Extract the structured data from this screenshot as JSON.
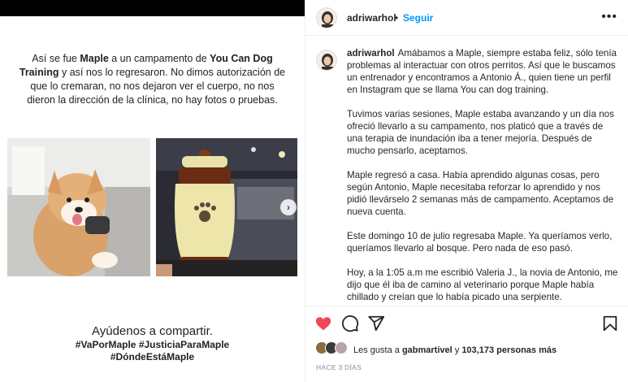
{
  "post_image": {
    "intro": {
      "t1": "Así se fue ",
      "name": "Maple",
      "t2": " a un campamento de ",
      "brand": "You Can Dog Training",
      "t3": " y así nos lo regresaron. No dimos autorización de que lo cremaran, no nos dejaron ver el cuerpo, no nos dieron la dirección de la clínica, no hay fotos o pruebas."
    },
    "cta": "Ayúdenos a compartir.",
    "hashtags_1": "#VaPorMaple #JusticiaParaMaple",
    "hashtags_2": "#DóndeEstáMaple",
    "next_icon": "chevron-right-icon"
  },
  "header": {
    "username": "adriwarhol",
    "separator": "•",
    "follow_label": "Seguir",
    "more_icon": "more-horizontal-icon"
  },
  "caption": {
    "username": "adriwarhol",
    "p1": "Amábamos a Maple, siempre estaba feliz, sólo tenía problemas al interactuar con otros perritos. Así que le buscamos un entrenador y encontramos a Antonio Á., quien tiene un perfil en Instagram que se llama You can dog training.",
    "p2": "Tuvimos varias sesiones, Maple estaba avanzando y un día nos ofreció llevarlo a su campamento, nos platicó que a través de una terapia de inundación iba a tener mejoría. Después de mucho pensarlo, aceptamos.",
    "p3": "Maple regresó a casa. Había aprendido algunas cosas, pero según Antonio, Maple necesitaba reforzar lo aprendido y nos pidió llevárselo 2 semanas más de campamento. Aceptamos de nueva cuenta.",
    "p4": "Este domingo 10 de julio regresaba Maple. Ya queríamos verlo, queríamos llevarlo al bosque. Pero nada de eso pasó.",
    "p5": "Hoy, a la 1:05 a.m me escribió Valeria J., la novia de Antonio, me dijo que él iba de camino al veterinario porque Maple había chillado y creían que lo había picado una serpiente."
  },
  "actions": {
    "like_icon": "heart-filled-icon",
    "comment_icon": "comment-icon",
    "share_icon": "send-icon",
    "save_icon": "bookmark-icon",
    "like_color": "#ed4956",
    "likes_prefix": "Les gusta a ",
    "likes_user": "gabmartivel",
    "likes_mid": " y ",
    "likes_count": "103,173 personas más",
    "timestamp": "HACE 3 DÍAS"
  }
}
